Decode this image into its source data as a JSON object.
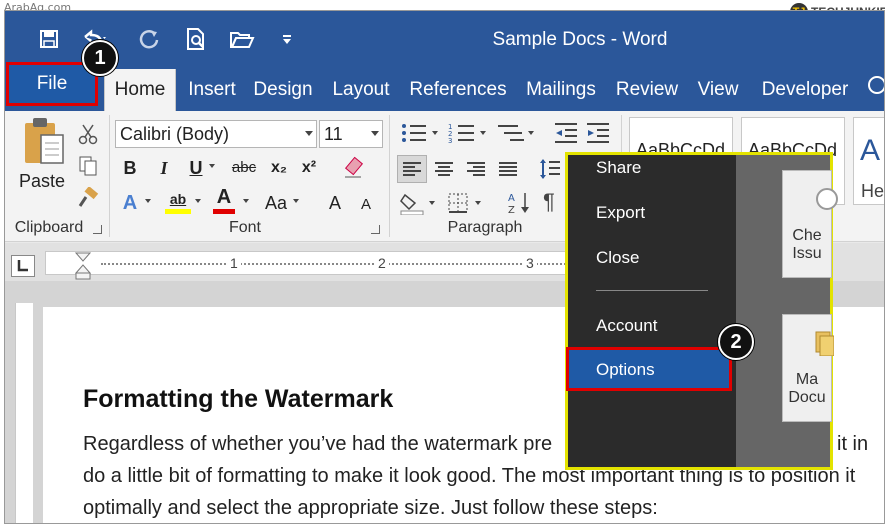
{
  "watermarks": {
    "left": "ArabAq.com",
    "right_logo": "TJ",
    "right_text": "TECHJUNKIE"
  },
  "titlebar": {
    "title": "Sample Docs - Word"
  },
  "quick_access": [
    {
      "name": "save-icon"
    },
    {
      "name": "undo-icon"
    },
    {
      "name": "redo-icon"
    },
    {
      "name": "print-preview-icon"
    },
    {
      "name": "open-folder-icon"
    },
    {
      "name": "customize-qat-icon"
    }
  ],
  "tabs": {
    "file": "File",
    "home": "Home",
    "insert": "Insert",
    "design": "Design",
    "layout": "Layout",
    "references": "References",
    "mailings": "Mailings",
    "review": "Review",
    "view": "View",
    "developer": "Developer"
  },
  "ribbon": {
    "clipboard": {
      "label": "Clipboard",
      "paste": "Paste"
    },
    "font": {
      "label": "Font",
      "name": "Calibri (Body)",
      "size": "11",
      "bold": "B",
      "italic": "I",
      "underline": "U",
      "strike": "abc",
      "subscript": "x₂",
      "superscript": "x²",
      "text_effects": "A",
      "highlight": "ab",
      "font_color": "A",
      "change_case": "Aa",
      "grow": "A",
      "shrink": "A"
    },
    "paragraph": {
      "label": "Paragraph"
    },
    "styles": {
      "normal": "AaBbCcDd",
      "no_spacing": "AaBbCcDd",
      "heading": "A",
      "heading_cut": "He"
    }
  },
  "ruler": {
    "marks": [
      "1",
      "2",
      "3"
    ]
  },
  "document": {
    "heading": "Formatting the Watermark",
    "lines": [
      "Regardless of whether you’ve had the watermark pre",
      "do a little bit of formatting to make it look good. The most important thing is to position it",
      "optimally and select the appropriate size. Just follow these steps:"
    ],
    "line1_tail": "it in"
  },
  "backstage": {
    "items": [
      "Share",
      "Export",
      "Close",
      "Account",
      "Options"
    ],
    "cards": [
      {
        "line1": "Che",
        "line2": "Issu"
      },
      {
        "line1": "Ma",
        "line2": "Docu"
      }
    ]
  },
  "markers": {
    "step1": "1",
    "step2": "2"
  },
  "colors": {
    "title_bar": "#2b579a",
    "highlight_box": "#e00000",
    "popup_border": "#e3e300"
  }
}
